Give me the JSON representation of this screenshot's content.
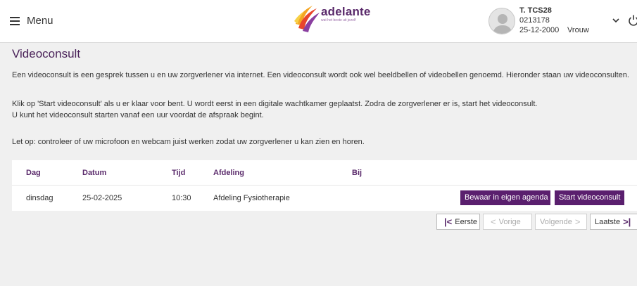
{
  "header": {
    "menu_label": "Menu",
    "logo_text": "adelante",
    "logo_tagline": "wat het beste uit jezelf",
    "patient": {
      "name": "T. TCS28",
      "id": "0213178",
      "dob": "25-12-2000",
      "gender": "Vrouw"
    }
  },
  "page": {
    "title": "Videoconsult",
    "intro": "Een videoconsult is een gesprek tussen u en uw zorgverlener via internet. Een videoconsult wordt ook wel beeldbellen of videobellen genoemd. Hieronder staan uw videoconsulten.",
    "instruction_1": "Klik op 'Start videoconsult' als u er klaar voor bent. U wordt eerst in een digitale wachtkamer geplaatst. Zodra de zorgverlener er is, start het videoconsult.",
    "instruction_2": "U kunt het videoconsult starten vanaf een uur voordat de afspraak begint.",
    "note": "Let op: controleer of uw microfoon en webcam juist werken zodat uw zorgverlener u kan zien en horen."
  },
  "table": {
    "headers": {
      "dag": "Dag",
      "datum": "Datum",
      "tijd": "Tijd",
      "afdeling": "Afdeling",
      "bij": "Bij"
    },
    "rows": [
      {
        "dag": "dinsdag",
        "datum": "25-02-2025",
        "tijd": "10:30",
        "afdeling": "Afdeling Fysiotherapie",
        "bij": "",
        "agenda_label": "Bewaar in eigen agenda",
        "start_label": "Start videoconsult"
      }
    ]
  },
  "pagination": {
    "first": "Eerste",
    "prev": "Vorige",
    "next": "Volgende",
    "last": "Laatste"
  },
  "colors": {
    "brand_purple": "#5a1f6e",
    "heading_purple": "#4a2259",
    "background": "#f0f0f0"
  }
}
